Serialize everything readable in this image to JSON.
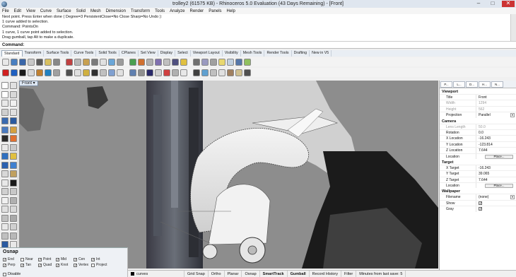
{
  "window": {
    "title": "trolley2 (61575 KB) - Rhinoceros 5.0 Evaluation (43 Days Remaining) - [Front]",
    "minimize": "–",
    "maximize": "□",
    "close": "✕"
  },
  "menu": [
    "File",
    "Edit",
    "View",
    "Curve",
    "Surface",
    "Solid",
    "Mesh",
    "Dimension",
    "Transform",
    "Tools",
    "Analyze",
    "Render",
    "Panels",
    "Help"
  ],
  "command_history": [
    "Next point. Press Enter when done ( Degree=3  PersistentClose=No  Close  Sharp=No  Undo ):",
    "1 curve added to selection.",
    "Command: PointsOn",
    "1 curve, 1 curve point added to selection.",
    "Drag gumball, tap Alt to make a duplicate."
  ],
  "command_prompt": "Command:",
  "toolbar_tabs": [
    "Standard",
    "Transform",
    "Surface Tools",
    "Curve Tools",
    "Solid Tools",
    "CPlanes",
    "Set View",
    "Display",
    "Select",
    "Viewport Layout",
    "Visibility",
    "Mesh Tools",
    "Render Tools",
    "Drafting",
    "New in V5"
  ],
  "toolbar_row1_colors": [
    "#e8e8e8",
    "#4a7fc0",
    "#3a66a8",
    "#c8c8c8",
    "#5a5a5a",
    "#d8c060",
    "#888888",
    "#c04040",
    "#b8b8b8",
    "#c8a050",
    "#7a7a7a",
    "#e0e0e0",
    "#6aa6d8",
    "#9b9b9b",
    "#4aa050",
    "#d07030",
    "#b0b0b0",
    "#8070b0",
    "#c0c0c0",
    "#505080",
    "#e0c040",
    "#707070",
    "#9a9ac0",
    "#a0a0a0",
    "#e8d870",
    "#c0d0e0",
    "#5577aa",
    "#90c060"
  ],
  "toolbar_row2_colors": [
    "#d02020",
    "#2060c0",
    "#1a1a1a",
    "#d8d8d8",
    "#c08030",
    "#2080c0",
    "#a0a0a0",
    "#505050",
    "#e0e0e0",
    "#d0b040",
    "#303030",
    "#c0c0c0",
    "#80a0d0",
    "#e0e0e0",
    "#6080b0",
    "#909090",
    "#2a2a6a",
    "#d0d0d0",
    "#d04040",
    "#b0b0b0",
    "#e8e8e8",
    "#404040",
    "#60a0d0",
    "#c0c0c0",
    "#e0e0e0",
    "#a08060",
    "#d0c090",
    "#505050"
  ],
  "left_toolbar_colors": [
    "#ffffff",
    "#e0e0e0",
    "#ffffff",
    "#d8d8d8",
    "#e8e8e8",
    "#f0f0f0",
    "#cfcfcf",
    "#e0e0e0",
    "#3a6ab0",
    "#2a5aa0",
    "#4a7ac0",
    "#d4a040",
    "#2a2a2a",
    "#e07030",
    "#e8e8e8",
    "#c8c8c8",
    "#3070c0",
    "#e0c040",
    "#2a60b0",
    "#4080d0",
    "#d8d8d8",
    "#c0a060",
    "#e8e8e8",
    "#1a1a1a",
    "#d0d0d0",
    "#c8c8c8",
    "#f0f0f0",
    "#b0b0b0",
    "#e0e0e0",
    "#d8d8d8",
    "#c0c0c0",
    "#a8a8a8",
    "#e8e8e8",
    "#d0d0d0",
    "#c0c0c0",
    "#b8b8b8",
    "#2a5aa0",
    "#e8e8e8"
  ],
  "viewport": {
    "label": "Front"
  },
  "osnap": {
    "title": "Osnap",
    "items": [
      {
        "label": "End",
        "checked": true
      },
      {
        "label": "Near",
        "checked": false
      },
      {
        "label": "Point",
        "checked": true
      },
      {
        "label": "Mid",
        "checked": true
      },
      {
        "label": "Cen",
        "checked": true
      },
      {
        "label": "Int",
        "checked": true
      },
      {
        "label": "",
        "checked": false
      },
      {
        "label": "Perp",
        "checked": true
      },
      {
        "label": "Tan",
        "checked": true
      },
      {
        "label": "Quad",
        "checked": true
      },
      {
        "label": "Knot",
        "checked": true
      },
      {
        "label": "Vertex",
        "checked": true
      },
      {
        "label": "Project",
        "checked": false
      },
      {
        "label": "",
        "checked": false
      }
    ],
    "disable_label": "Disable"
  },
  "status": {
    "layer": "curves",
    "cells": [
      "Grid Snap",
      "Ortho",
      "Planar",
      "Osnap",
      "SmartTrack",
      "Gumball",
      "Record History",
      "Filter",
      "Minutes from last save: 5"
    ]
  },
  "properties": {
    "tabs": [
      "P...",
      "L...",
      "D...",
      "H...",
      "N..."
    ],
    "sections": [
      {
        "title": "Viewport",
        "rows": [
          {
            "key": "Title",
            "value": "Front",
            "dim": false
          },
          {
            "key": "Width",
            "value": "1294",
            "dim": true
          },
          {
            "key": "Height",
            "value": "562",
            "dim": true
          },
          {
            "key": "Projection",
            "value": "Parallel",
            "dim": false,
            "dropdown": true
          }
        ]
      },
      {
        "title": "Camera",
        "rows": [
          {
            "key": "Lens Length",
            "value": "50.0",
            "dim": true
          },
          {
            "key": "Rotation",
            "value": "0.0",
            "dim": false
          },
          {
            "key": "X Location",
            "value": "-16.243",
            "dim": false
          },
          {
            "key": "Y Location",
            "value": "-123.814",
            "dim": false
          },
          {
            "key": "Z Location",
            "value": "7.644",
            "dim": false
          },
          {
            "key": "Location",
            "button": "Place...",
            "dim": false
          }
        ]
      },
      {
        "title": "Target",
        "rows": [
          {
            "key": "X Target",
            "value": "-16.243",
            "dim": false
          },
          {
            "key": "Y Target",
            "value": "39.065",
            "dim": false
          },
          {
            "key": "Z Target",
            "value": "7.644",
            "dim": false
          },
          {
            "key": "Location",
            "button": "Place...",
            "dim": false
          }
        ]
      },
      {
        "title": "Wallpaper",
        "rows": [
          {
            "key": "Filename",
            "value": "(none)",
            "dim": false,
            "dropdown": true
          },
          {
            "key": "Show",
            "checkbox": true,
            "dim": false
          },
          {
            "key": "Gray",
            "checkbox": true,
            "dim": false
          }
        ]
      }
    ]
  }
}
